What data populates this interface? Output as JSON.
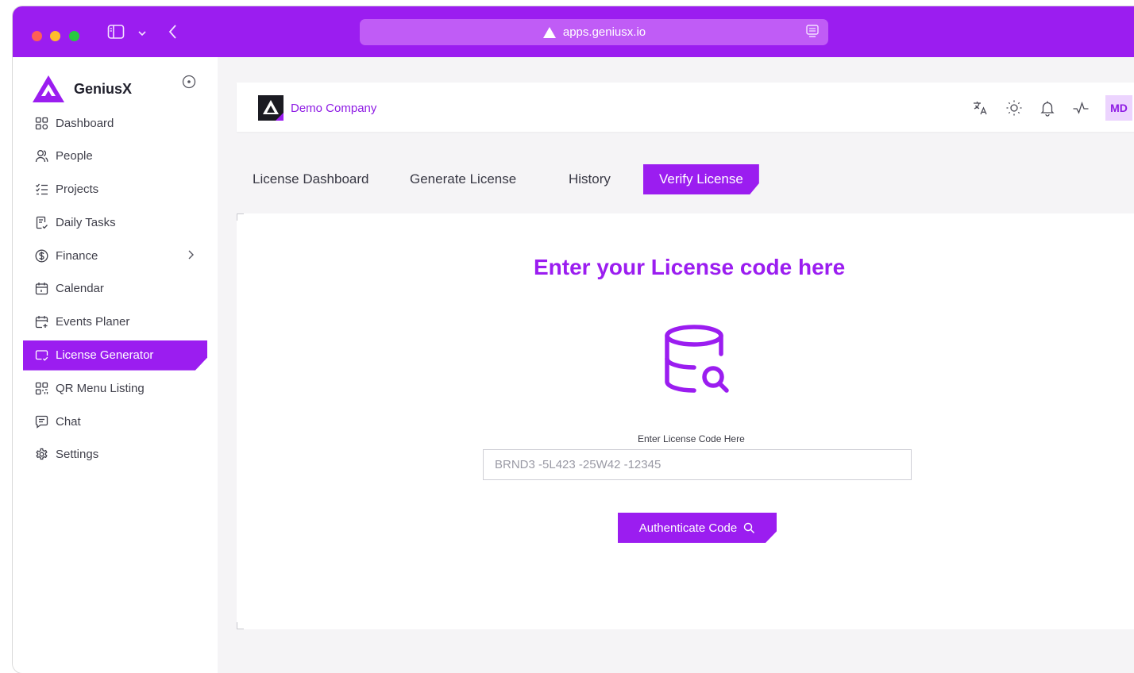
{
  "browser": {
    "url": "apps.geniusx.io"
  },
  "sidebar": {
    "brand": "GeniusX",
    "items": [
      {
        "label": "Dashboard",
        "icon": "dashboard-grid-icon"
      },
      {
        "label": "People",
        "icon": "people-icon"
      },
      {
        "label": "Projects",
        "icon": "checklist-icon"
      },
      {
        "label": "Daily Tasks",
        "icon": "task-list-icon"
      },
      {
        "label": "Finance",
        "icon": "dollar-circle-icon"
      },
      {
        "label": "Calendar",
        "icon": "calendar-icon"
      },
      {
        "label": "Events Planer",
        "icon": "calendar-plus-icon"
      },
      {
        "label": "License Generator",
        "icon": "license-icon"
      },
      {
        "label": "QR Menu Listing",
        "icon": "qr-icon"
      },
      {
        "label": "Chat",
        "icon": "chat-icon"
      },
      {
        "label": "Settings",
        "icon": "settings-icon"
      }
    ],
    "active_index": 7
  },
  "header": {
    "company": "Demo Company",
    "avatar_initials": "MD"
  },
  "tabs": [
    {
      "label": "License Dashboard"
    },
    {
      "label": "Generate License"
    },
    {
      "label": "History"
    },
    {
      "label": "Verify License"
    }
  ],
  "verify": {
    "title": "Enter your License code here",
    "field_label": "Enter License Code Here",
    "placeholder": "BRND3 -5L423 -25W42 -12345",
    "button_label": "Authenticate Code"
  },
  "colors": {
    "accent": "#9b1df0",
    "titlebar": "#9b1df0"
  }
}
